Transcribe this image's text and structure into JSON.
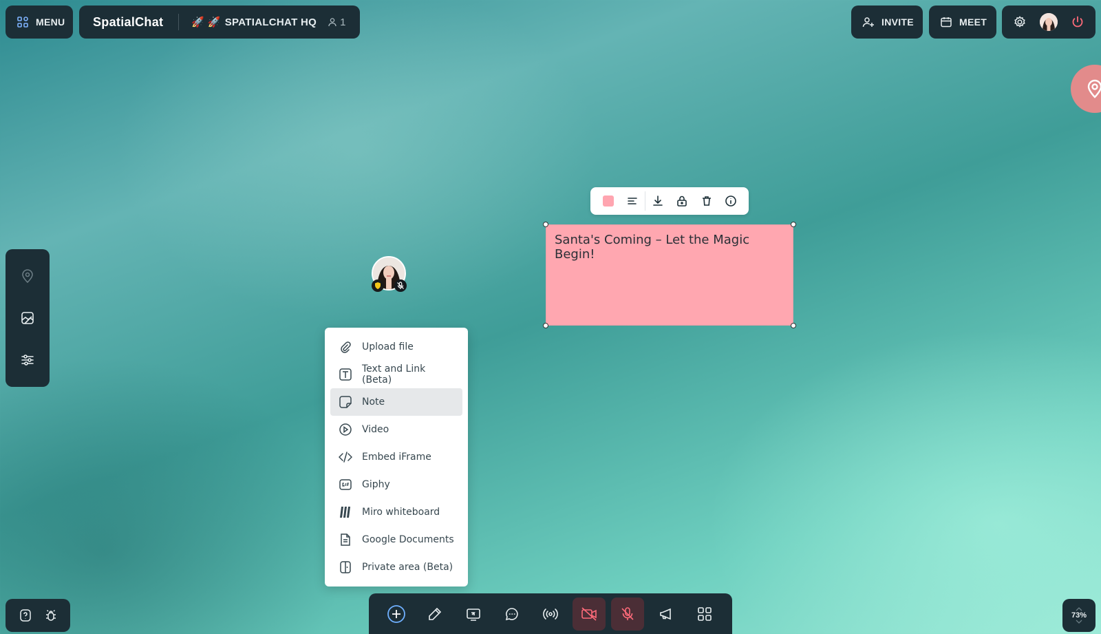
{
  "header": {
    "menu_label": "MENU",
    "brand": "SpatialChat",
    "room_name": "SPATIALCHAT HQ",
    "room_emoji": "🚀 🚀",
    "user_count": "1",
    "invite_label": "INVITE",
    "meet_label": "MEET"
  },
  "note": {
    "text": "Santa's Coming – Let the Magic Begin!",
    "color": "#ffa7b0"
  },
  "add_menu": {
    "items": [
      {
        "label": "Upload file",
        "icon": "paperclip-icon"
      },
      {
        "label": "Text and Link (Beta)",
        "icon": "text-icon"
      },
      {
        "label": "Note",
        "icon": "note-icon"
      },
      {
        "label": "Video",
        "icon": "play-icon"
      },
      {
        "label": "Embed iFrame",
        "icon": "code-icon"
      },
      {
        "label": "Giphy",
        "icon": "gif-icon"
      },
      {
        "label": "Miro whiteboard",
        "icon": "miro-icon"
      },
      {
        "label": "Google Documents",
        "icon": "document-icon"
      },
      {
        "label": "Private area (Beta)",
        "icon": "private-area-icon"
      }
    ],
    "selected": "Note"
  },
  "zoom": {
    "level": "73%"
  }
}
